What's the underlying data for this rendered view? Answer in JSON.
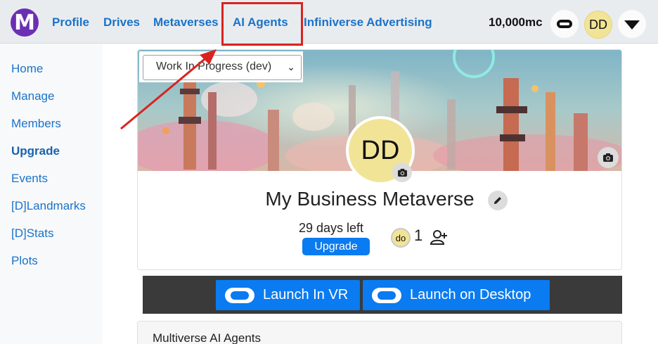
{
  "logo": {
    "letter": "M"
  },
  "nav": {
    "items": [
      {
        "label": "Profile"
      },
      {
        "label": "Drives"
      },
      {
        "label": "Metaverses"
      },
      {
        "label": "AI Agents"
      },
      {
        "label": "Infiniverse Advertising"
      }
    ],
    "balance": "10,000mc",
    "avatar_initials": "DD",
    "icons": [
      "vr-headset-icon",
      "dropdown-triangle-icon"
    ]
  },
  "sidebar": {
    "items": [
      {
        "label": "Home"
      },
      {
        "label": "Manage"
      },
      {
        "label": "Members"
      },
      {
        "label": "Upgrade",
        "active": true
      },
      {
        "label": "Events"
      },
      {
        "label": "[D]Landmarks"
      },
      {
        "label": "[D]Stats"
      },
      {
        "label": "Plots"
      }
    ]
  },
  "metaverse": {
    "environment_select": "Work In Progress (dev)",
    "avatar_initials": "DD",
    "title": "My Business Metaverse",
    "days_left": "29 days left",
    "upgrade_label": "Upgrade",
    "member_initials": "do",
    "member_count": "1"
  },
  "launch": {
    "vr_label": "Launch In VR",
    "desktop_label": "Launch on Desktop"
  },
  "agents": {
    "title": "Multiverse AI Agents"
  },
  "colors": {
    "accent": "#0a7bf0",
    "link": "#1a73c9",
    "logo": "#6b2fb3",
    "highlight": "#d9231f",
    "avatar": "#f2e496"
  }
}
